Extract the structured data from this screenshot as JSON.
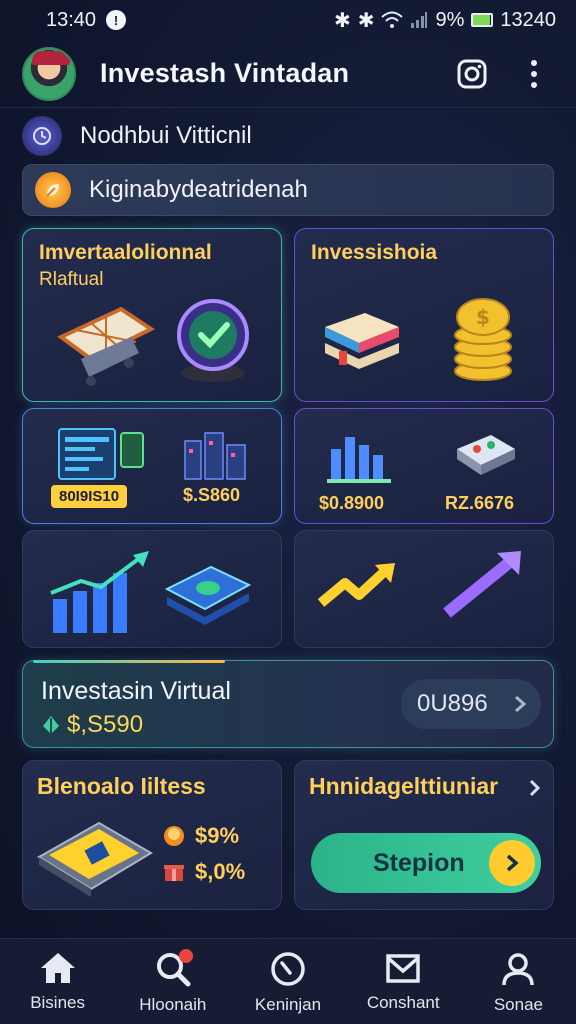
{
  "status_bar": {
    "time": "13:40",
    "battery_text": "9%",
    "clock_right": "13240",
    "battery_level": 0.9
  },
  "header": {
    "title": "Investash Vintadan",
    "icons": [
      "instagram-icon",
      "more-vert-icon"
    ]
  },
  "rows": [
    {
      "label": "Nodhbui Vitticnil",
      "icon": "clock-icon"
    },
    {
      "label": "Kiginabydeatridenah",
      "icon": "leaf-icon"
    }
  ],
  "cards": [
    {
      "title": "Imvertaalolionnal",
      "subtitle": "Rlaftual"
    },
    {
      "title": "Invessishoia",
      "subtitle": ""
    },
    {
      "values": [
        "80I9IS10",
        "$.S860"
      ]
    },
    {
      "values": [
        "$0.8900",
        "RZ.6676"
      ]
    },
    {},
    {}
  ],
  "virtual": {
    "title": "Investasin Virtual",
    "balance": "$,S590",
    "pill_value": "0U896"
  },
  "bottom_left": {
    "title": "Blenoalo Iiltess",
    "stats": [
      "$9%",
      "$,0%"
    ]
  },
  "bottom_right": {
    "title": "Hnnidagelttiuniar",
    "button": "Stepion"
  },
  "nav": [
    {
      "label": "Bisines",
      "icon": "home-icon"
    },
    {
      "label": "Hloonaih",
      "icon": "search-icon",
      "badge": true
    },
    {
      "label": "Keninjan",
      "icon": "compass-icon"
    },
    {
      "label": "Conshant",
      "icon": "mail-icon"
    },
    {
      "label": "Sonae",
      "icon": "user-icon"
    }
  ],
  "colors": {
    "accent_gold": "#ffcf5c",
    "teal": "#3fb7b0",
    "green_button": "#2bb38a",
    "background": "#131a33"
  }
}
